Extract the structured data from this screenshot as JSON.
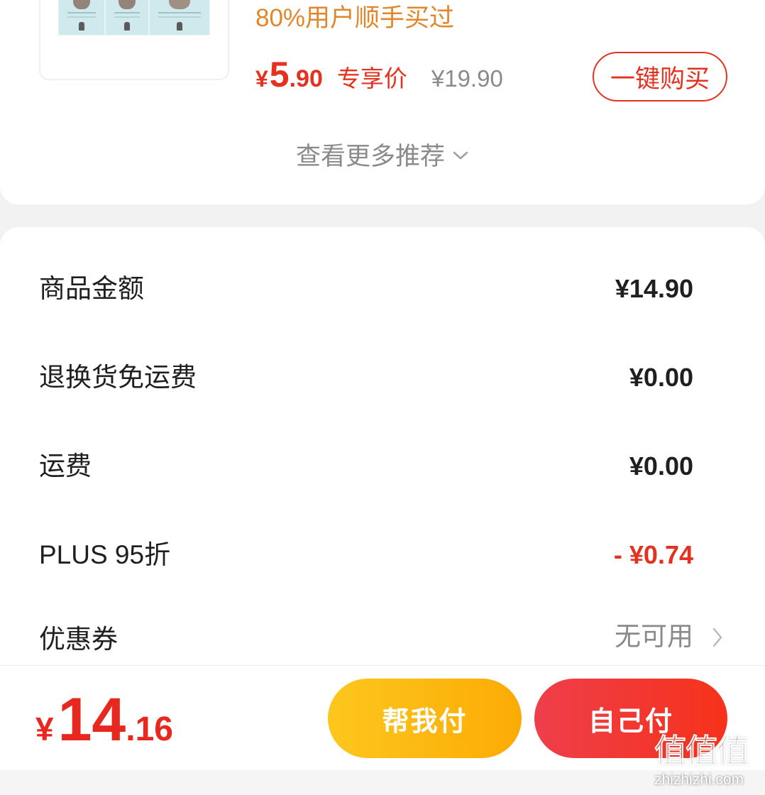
{
  "recommendation": {
    "tagline": "80%用户顺手买过",
    "price": {
      "currency": "¥",
      "integer": "5",
      "decimal": ".90"
    },
    "price_label": "专享价",
    "original_price": "¥19.90",
    "buy_button_label": "一键购买",
    "more_label": "查看更多推荐",
    "more_icon": "chevron-down-icon"
  },
  "summary": {
    "rows": [
      {
        "label": "商品金额",
        "value": "¥14.90"
      },
      {
        "label": "退换货免运费",
        "value": "¥0.00"
      },
      {
        "label": "运费",
        "value": "¥0.00"
      },
      {
        "label": "PLUS 95折",
        "value": "- ¥0.74"
      },
      {
        "label": "优惠券",
        "value": "无可用",
        "icon": "chevron-right-icon"
      }
    ]
  },
  "footer": {
    "total": {
      "currency": "¥",
      "integer": "14",
      "decimal": ".16"
    },
    "help_pay_label": "帮我付",
    "self_pay_label": "自己付"
  },
  "watermark": {
    "logo_text": "值值值",
    "url": "zhizhizhi.com"
  },
  "colors": {
    "accent_red": "#e5311f",
    "tagline_orange": "#e3862a",
    "muted_gray": "#8a8a8a",
    "help_pay_gradient": [
      "#fdc71e",
      "#fbab04"
    ],
    "self_pay_gradient": [
      "#ee3e4b",
      "#f6321a"
    ]
  }
}
